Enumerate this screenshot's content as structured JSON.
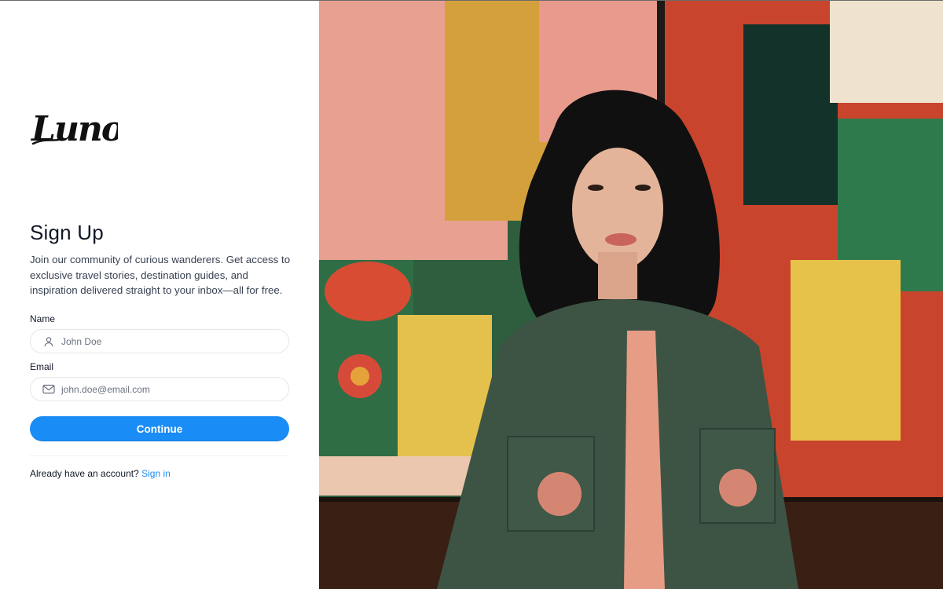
{
  "brand": {
    "logo_text": "Luno"
  },
  "signup": {
    "title": "Sign Up",
    "description": "Join our community of curious wanderers. Get access to exclusive travel stories, destination guides, and inspiration delivered straight to your inbox—all for free.",
    "name": {
      "label": "Name",
      "placeholder": "John Doe",
      "icon": "user-icon"
    },
    "email": {
      "label": "Email",
      "placeholder": "john.doe@email.com",
      "icon": "mail-icon"
    },
    "continue_label": "Continue",
    "account_prompt": "Already have an account?",
    "signin_link": "Sign in"
  },
  "colors": {
    "accent": "#1a8cf5",
    "text_primary": "#111827",
    "text_secondary": "#374151",
    "input_border": "#e5e7eb"
  },
  "hero_image": {
    "icon": "portrait-photo"
  }
}
